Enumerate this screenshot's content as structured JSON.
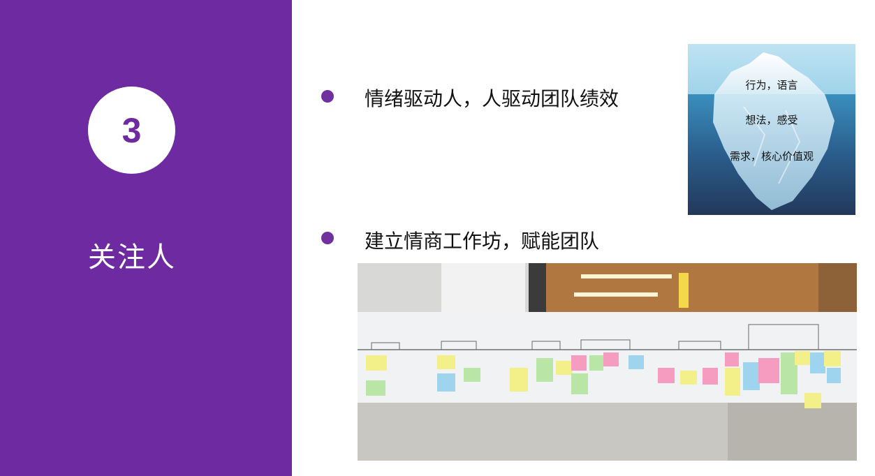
{
  "sidebar": {
    "number": "3",
    "title": "关注人"
  },
  "bullets": [
    {
      "text": "情绪驱动人，人驱动团队绩效"
    },
    {
      "text": "建立情商工作坊，赋能团队"
    }
  ],
  "iceberg": {
    "labels": [
      "行为，语言",
      "想法，感受",
      "需求，核心价值观"
    ]
  },
  "colors": {
    "accent": "#6e2aa0",
    "bullet": "#7030a0"
  },
  "photo": {
    "description_icon": "workshop-photo"
  }
}
